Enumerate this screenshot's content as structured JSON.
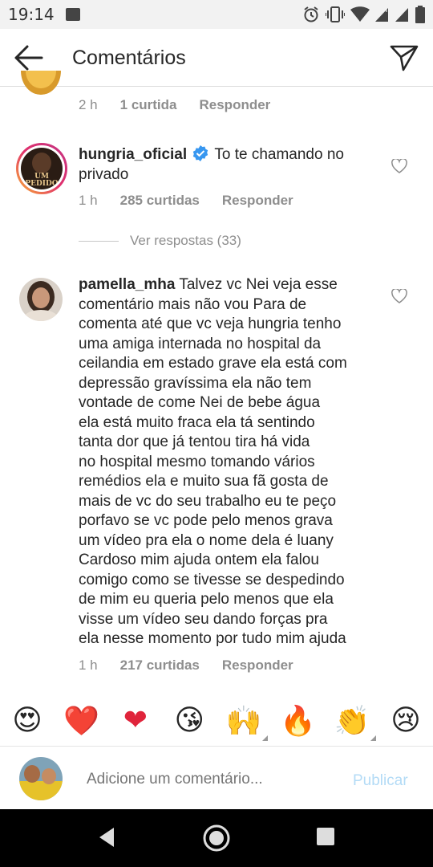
{
  "status_bar": {
    "time": "19:14",
    "icons": [
      "image-icon",
      "alarm-icon",
      "vibrate-icon",
      "wifi-icon",
      "signal-icon",
      "signal-icon",
      "battery-icon"
    ]
  },
  "header": {
    "title": "Comentários",
    "back_icon": "arrow-left-icon",
    "send_icon": "paper-plane-icon"
  },
  "comments": [
    {
      "id": "c0",
      "time": "2 h",
      "likes": "1 curtida",
      "reply": "Responder"
    },
    {
      "id": "c1",
      "username": "hungria_oficial",
      "verified": true,
      "text": "To te chamando no privado",
      "avatar_text": "UM PEDIDO",
      "time": "1 h",
      "likes": "285 curtidas",
      "reply": "Responder",
      "view_replies": "Ver respostas (33)"
    },
    {
      "id": "c2",
      "username": "pamella_mha",
      "text_lines": [
        "Talvez vc Nei veja esse",
        "comentário mais não vou Para de",
        "comenta até que vc veja hungria tenho",
        "uma amiga internada no hospital da",
        "ceilandia em estado grave ela está com",
        "depressão gravíssima  ela não tem",
        "vontade de come Nei de bebe água",
        "ela está muito fraca ela tá sentindo",
        "tanta dor que já tentou tira há vida",
        "no hospital mesmo tomando vários",
        "remédios ela e muito sua fã gosta de",
        "mais de vc do seu trabalho eu te peço",
        "porfavo se vc pode pelo menos grava",
        "um vídeo pra ela o nome dela é luany",
        "Cardoso mim ajuda ontem ela falou",
        "comigo como se tivesse se despedindo",
        "de mim eu queria pelo menos que ela",
        "visse um vídeo seu dando forças  pra",
        "ela nesse momento por tudo mim ajuda"
      ],
      "time": "1 h",
      "likes": "217 curtidas",
      "reply": "Responder"
    }
  ],
  "emoji_bar": [
    "😍",
    "❤️",
    "❤",
    "😘",
    "🙌",
    "🔥",
    "👏",
    "😢"
  ],
  "add_comment": {
    "placeholder": "Adicione um comentário...",
    "publish": "Publicar"
  },
  "nav_bar": {
    "back": "triangle-back-icon",
    "home": "circle-home-icon",
    "recents": "square-recents-icon"
  },
  "colors": {
    "link_disabled": "#b3dbf6",
    "verified": "#3897f0",
    "meta_gray": "#8e8e8e",
    "heart_red": "#e0243b"
  }
}
